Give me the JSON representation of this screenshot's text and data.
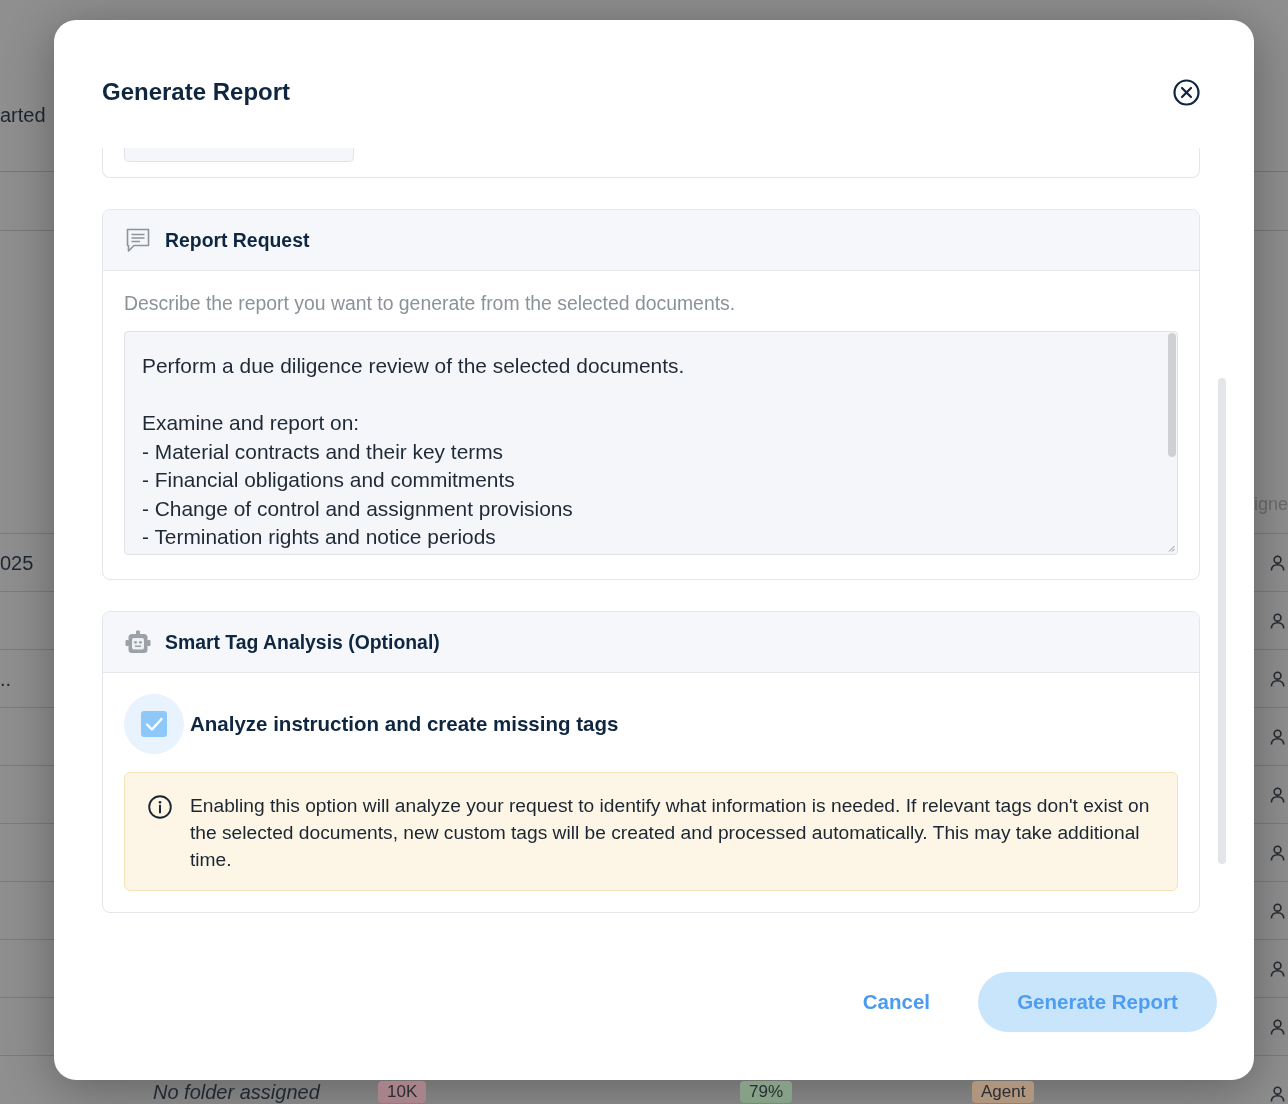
{
  "background": {
    "top_label": "arted",
    "column_header": "igne",
    "rows": [
      {
        "column_1": "025"
      },
      {},
      {
        "column_1": ".."
      },
      {},
      {},
      {},
      {},
      {},
      {},
      {
        "column_2": "No folder assigned",
        "badges": [
          {
            "text": "10K",
            "color": "#a8848a"
          },
          {
            "text": "79%",
            "color": "#86a187"
          },
          {
            "text": "Agent",
            "color": "#b0957f"
          }
        ]
      }
    ]
  },
  "dialog": {
    "title": "Generate Report"
  },
  "report_request": {
    "title": "Report Request",
    "description": "Describe the report you want to generate from the selected documents.",
    "request": {
      "value": "Perform a due diligence review of the selected documents.\n\nExamine and report on:\n- Material contracts and their key terms\n- Financial obligations and commitments\n- Change of control and assignment provisions\n- Termination rights and notice periods"
    }
  },
  "smart_tags": {
    "title": "Smart Tag Analysis (Optional)",
    "option": {
      "label": "Analyze instruction and create missing tags",
      "checked": true
    },
    "info": "Enabling this option will analyze your request to identify what information is needed. If relevant tags don't exist on the selected documents, new custom tags will be created and processed automatically. This may take additional time."
  },
  "buttons": [
    {
      "label": "Cancel",
      "kind": "text"
    },
    {
      "label": "Generate Report",
      "kind": "primary"
    }
  ]
}
